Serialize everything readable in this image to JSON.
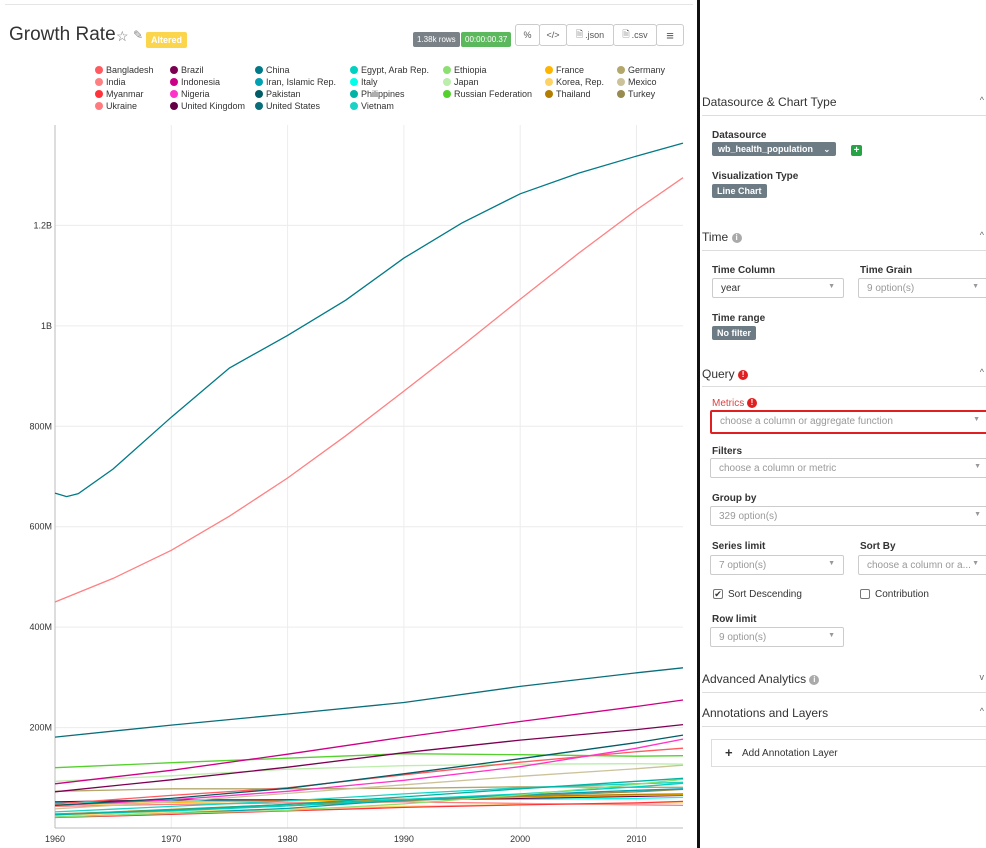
{
  "chart": {
    "title": "Growth Rate",
    "altered_label": "Altered",
    "rows_badge": "1.38k rows",
    "time_badge": "00:00:00.37",
    "buttons": {
      "link": "%",
      "embed": "</>",
      "json": ".json",
      "csv": ".csv",
      "menu": "≡"
    }
  },
  "legend": [
    {
      "name": "Bangladesh",
      "color": "#ff5a5f"
    },
    {
      "name": "Brazil",
      "color": "#7b0051"
    },
    {
      "name": "China",
      "color": "#007a87"
    },
    {
      "name": "Egypt, Arab Rep.",
      "color": "#00d1c1"
    },
    {
      "name": "Ethiopia",
      "color": "#8ce071"
    },
    {
      "name": "France",
      "color": "#ffb400"
    },
    {
      "name": "Germany",
      "color": "#b4a76c"
    },
    {
      "name": "India",
      "color": "#ff8083"
    },
    {
      "name": "Indonesia",
      "color": "#cc0086"
    },
    {
      "name": "Iran, Islamic Rep.",
      "color": "#00a1b3"
    },
    {
      "name": "Italy",
      "color": "#00ffeb"
    },
    {
      "name": "Japan",
      "color": "#bbedab"
    },
    {
      "name": "Korea, Rep.",
      "color": "#ffd266"
    },
    {
      "name": "Mexico",
      "color": "#cbc29a"
    },
    {
      "name": "Myanmar",
      "color": "#ff3339"
    },
    {
      "name": "Nigeria",
      "color": "#ff33c9"
    },
    {
      "name": "Pakistan",
      "color": "#005c66"
    },
    {
      "name": "Philippines",
      "color": "#00b3a5"
    },
    {
      "name": "Russian Federation",
      "color": "#55d12e"
    },
    {
      "name": "Thailand",
      "color": "#b37e00"
    },
    {
      "name": "Turkey",
      "color": "#988b4e"
    },
    {
      "name": "Ukraine",
      "color": "#ff7b7f"
    },
    {
      "name": "United Kingdom",
      "color": "#660044"
    },
    {
      "name": "United States",
      "color": "#0a6e7a"
    },
    {
      "name": "Vietnam",
      "color": "#1ad3c4"
    }
  ],
  "chart_data": {
    "type": "line",
    "title": "Growth Rate",
    "xlabel": "",
    "ylabel": "",
    "xlim": [
      1960,
      2014
    ],
    "ylim": [
      0,
      1400000000
    ],
    "x_ticks": [
      "1960",
      "1970",
      "1980",
      "1990",
      "2000",
      "2010"
    ],
    "y_ticks": [
      "200M",
      "400M",
      "600M",
      "800M",
      "1B",
      "1.2B"
    ],
    "grid": true,
    "legend_position": "top",
    "series": [
      {
        "name": "China",
        "x": [
          1960,
          1961,
          1962,
          1965,
          1970,
          1975,
          1980,
          1985,
          1990,
          1995,
          2000,
          2005,
          2010,
          2014
        ],
        "y": [
          667000000,
          660000000,
          666000000,
          715000000,
          818000000,
          916000000,
          981000000,
          1051000000,
          1135000000,
          1205000000,
          1263000000,
          1304000000,
          1338000000,
          1364000000
        ]
      },
      {
        "name": "India",
        "x": [
          1960,
          1965,
          1970,
          1975,
          1980,
          1985,
          1990,
          1995,
          2000,
          2005,
          2010,
          2014
        ],
        "y": [
          450000000,
          497000000,
          553000000,
          621000000,
          697000000,
          781000000,
          870000000,
          960000000,
          1053000000,
          1144000000,
          1231000000,
          1295000000
        ]
      },
      {
        "name": "United States",
        "x": [
          1960,
          1970,
          1980,
          1990,
          2000,
          2010,
          2014
        ],
        "y": [
          181000000,
          205000000,
          227000000,
          250000000,
          282000000,
          309000000,
          319000000
        ]
      },
      {
        "name": "Indonesia",
        "x": [
          1960,
          1970,
          1980,
          1990,
          2000,
          2010,
          2014
        ],
        "y": [
          88000000,
          115000000,
          147000000,
          181000000,
          212000000,
          242000000,
          255000000
        ]
      },
      {
        "name": "Brazil",
        "x": [
          1960,
          1970,
          1980,
          1990,
          2000,
          2010,
          2014
        ],
        "y": [
          72000000,
          96000000,
          121000000,
          150000000,
          175000000,
          196000000,
          206000000
        ]
      },
      {
        "name": "Pakistan",
        "x": [
          1960,
          1970,
          1980,
          1990,
          2000,
          2010,
          2014
        ],
        "y": [
          45000000,
          59000000,
          79000000,
          108000000,
          138000000,
          170000000,
          185000000
        ]
      },
      {
        "name": "Nigeria",
        "x": [
          1960,
          1970,
          1980,
          1990,
          2000,
          2010,
          2014
        ],
        "y": [
          45000000,
          56000000,
          73000000,
          95000000,
          122000000,
          159000000,
          177000000
        ]
      },
      {
        "name": "Bangladesh",
        "x": [
          1960,
          1970,
          1980,
          1990,
          2000,
          2010,
          2014
        ],
        "y": [
          48000000,
          65000000,
          80000000,
          106000000,
          131000000,
          152000000,
          159000000
        ]
      },
      {
        "name": "Russian Federation",
        "x": [
          1960,
          1970,
          1980,
          1990,
          2000,
          2010,
          2014
        ],
        "y": [
          120000000,
          130000000,
          139000000,
          148000000,
          146000000,
          143000000,
          144000000
        ]
      },
      {
        "name": "Japan",
        "x": [
          1960,
          1970,
          1980,
          1990,
          2000,
          2010,
          2014
        ],
        "y": [
          93000000,
          104000000,
          117000000,
          124000000,
          127000000,
          128000000,
          127000000
        ]
      },
      {
        "name": "Mexico",
        "x": [
          1960,
          1970,
          1980,
          1990,
          2000,
          2010,
          2014
        ],
        "y": [
          38000000,
          52000000,
          69000000,
          86000000,
          103000000,
          118000000,
          125000000
        ]
      },
      {
        "name": "Philippines",
        "x": [
          1960,
          1970,
          1980,
          1990,
          2000,
          2010,
          2014
        ],
        "y": [
          26000000,
          36000000,
          47000000,
          62000000,
          78000000,
          93000000,
          99000000
        ]
      },
      {
        "name": "Ethiopia",
        "x": [
          1960,
          1970,
          1980,
          1990,
          2000,
          2010,
          2014
        ],
        "y": [
          22000000,
          29000000,
          35000000,
          48000000,
          66000000,
          87000000,
          97000000
        ]
      },
      {
        "name": "Vietnam",
        "x": [
          1960,
          1970,
          1980,
          1990,
          2000,
          2010,
          2014
        ],
        "y": [
          32000000,
          43000000,
          54000000,
          68000000,
          80000000,
          88000000,
          91000000
        ]
      },
      {
        "name": "Egypt, Arab Rep.",
        "x": [
          1960,
          1970,
          1980,
          1990,
          2000,
          2010,
          2014
        ],
        "y": [
          27000000,
          34000000,
          44000000,
          57000000,
          68000000,
          82000000,
          89000000
        ]
      },
      {
        "name": "Germany",
        "x": [
          1960,
          1970,
          1980,
          1990,
          2000,
          2010,
          2014
        ],
        "y": [
          73000000,
          78000000,
          78000000,
          79000000,
          82000000,
          81000000,
          81000000
        ]
      },
      {
        "name": "Iran, Islamic Rep.",
        "x": [
          1960,
          1970,
          1980,
          1990,
          2000,
          2010,
          2014
        ],
        "y": [
          22000000,
          29000000,
          39000000,
          56000000,
          66000000,
          75000000,
          78000000
        ]
      },
      {
        "name": "Turkey",
        "x": [
          1960,
          1970,
          1980,
          1990,
          2000,
          2010,
          2014
        ],
        "y": [
          28000000,
          35000000,
          44000000,
          54000000,
          64000000,
          72000000,
          77000000
        ]
      },
      {
        "name": "Thailand",
        "x": [
          1960,
          1970,
          1980,
          1990,
          2000,
          2010,
          2014
        ],
        "y": [
          27000000,
          37000000,
          47000000,
          57000000,
          63000000,
          67000000,
          68000000
        ]
      },
      {
        "name": "France",
        "x": [
          1960,
          1970,
          1980,
          1990,
          2000,
          2010,
          2014
        ],
        "y": [
          46000000,
          51000000,
          54000000,
          57000000,
          61000000,
          65000000,
          66000000
        ]
      },
      {
        "name": "United Kingdom",
        "x": [
          1960,
          1970,
          1980,
          1990,
          2000,
          2010,
          2014
        ],
        "y": [
          52000000,
          56000000,
          56000000,
          57000000,
          59000000,
          63000000,
          65000000
        ]
      },
      {
        "name": "Italy",
        "x": [
          1960,
          1970,
          1980,
          1990,
          2000,
          2010,
          2014
        ],
        "y": [
          50000000,
          54000000,
          56000000,
          57000000,
          57000000,
          59000000,
          61000000
        ]
      },
      {
        "name": "Myanmar",
        "x": [
          1960,
          1970,
          1980,
          1990,
          2000,
          2010,
          2014
        ],
        "y": [
          21000000,
          27000000,
          34000000,
          41000000,
          46000000,
          50000000,
          53000000
        ]
      },
      {
        "name": "Korea, Rep.",
        "x": [
          1960,
          1970,
          1980,
          1990,
          2000,
          2010,
          2014
        ],
        "y": [
          25000000,
          32000000,
          38000000,
          43000000,
          47000000,
          49000000,
          50000000
        ]
      },
      {
        "name": "Ukraine",
        "x": [
          1960,
          1970,
          1980,
          1990,
          2000,
          2010,
          2014
        ],
        "y": [
          43000000,
          47000000,
          50000000,
          52000000,
          49000000,
          46000000,
          45000000
        ]
      }
    ]
  },
  "panel": {
    "datasource_section": "Datasource & Chart Type",
    "datasource_label": "Datasource",
    "datasource_value": "wb_health_population",
    "viz_label": "Visualization Type",
    "viz_value": "Line Chart",
    "time_section": "Time",
    "time_column_label": "Time Column",
    "time_column_value": "year",
    "time_grain_label": "Time Grain",
    "time_grain_placeholder": "9 option(s)",
    "time_range_label": "Time range",
    "time_range_value": "No filter",
    "query_section": "Query",
    "metrics_label": "Metrics",
    "metrics_placeholder": "choose a column or aggregate function",
    "filters_label": "Filters",
    "filters_placeholder": "choose a column or metric",
    "groupby_label": "Group by",
    "groupby_placeholder": "329 option(s)",
    "series_limit_label": "Series limit",
    "series_limit_placeholder": "7 option(s)",
    "sort_by_label": "Sort By",
    "sort_by_placeholder": "choose a column or a...",
    "sort_desc_label": "Sort Descending",
    "sort_desc_checked": true,
    "contribution_label": "Contribution",
    "contribution_checked": false,
    "row_limit_label": "Row limit",
    "row_limit_placeholder": "9 option(s)",
    "advanced_section": "Advanced Analytics",
    "annotations_section": "Annotations and Layers",
    "add_annotation_label": "Add Annotation Layer"
  }
}
